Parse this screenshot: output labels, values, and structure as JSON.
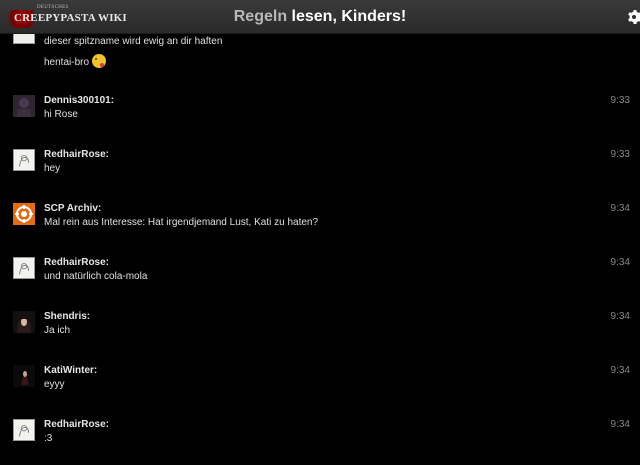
{
  "header": {
    "logo_small": "DEUTSCHES",
    "logo_main": "CREEPYPASTA WIKI",
    "title_part1": "Regeln",
    "title_part2": " lesen, Kinders!"
  },
  "messages": [
    {
      "text": "dieser spitzname wird ewig an dir haften"
    },
    {
      "text": "hentai-bro"
    },
    {
      "author": "Dennis300101:",
      "time": "9:33",
      "text": "hi Rose"
    },
    {
      "author": "RedhairRose:",
      "time": "9:33",
      "text": "hey"
    },
    {
      "author": "SCP Archiv:",
      "time": "9:34",
      "text": "Mal rein aus Interesse: Hat irgendjemand Lust, Kati zu haten?"
    },
    {
      "author": "RedhairRose:",
      "time": "9:34",
      "text": "und natürlich cola-mola"
    },
    {
      "author": "Shendris:",
      "time": "9:34",
      "text": "Ja ich"
    },
    {
      "author": "KatiWinter:",
      "time": "9:34",
      "text": "eyyy"
    },
    {
      "author": "RedhairRose:",
      "time": "9:34",
      "text": ":3"
    }
  ],
  "icons": {
    "gear": "gear-icon",
    "emoji": "tongue-out-emoji"
  }
}
